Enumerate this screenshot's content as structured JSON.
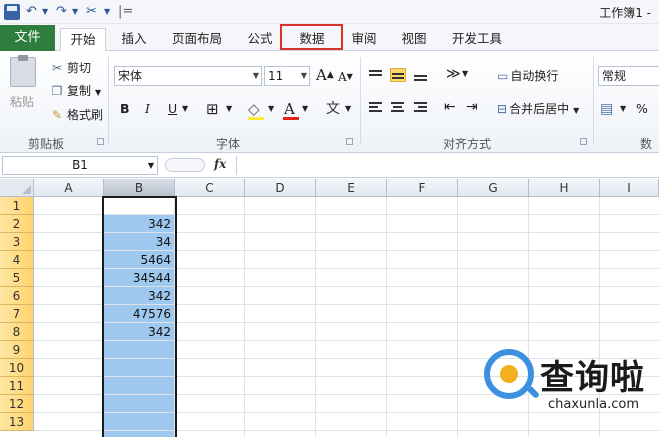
{
  "window": {
    "title": "工作簿1 -"
  },
  "quick_access": {
    "undo_glyph": "↶",
    "redo_glyph": "↷",
    "brush_glyph": "✂",
    "separator": "|="
  },
  "tabs": {
    "file": "文件",
    "items": [
      "开始",
      "插入",
      "页面布局",
      "公式",
      "数据",
      "审阅",
      "视图",
      "开发工具"
    ],
    "active": "开始",
    "highlighted": "数据"
  },
  "ribbon": {
    "clipboard": {
      "paste": "粘贴",
      "cut": "剪切",
      "copy": "复制",
      "format_painter": "格式刷",
      "group": "剪贴板"
    },
    "font": {
      "name": "宋体",
      "size": "11",
      "grow": "A",
      "shrink": "A",
      "bold": "B",
      "italic": "I",
      "underline": "U",
      "border": "⊞",
      "fill": "◇",
      "color": "A",
      "phonetic": "文",
      "group": "字体"
    },
    "alignment": {
      "wrap_text": "自动换行",
      "merge_center": "合并后居中",
      "group": "对齐方式"
    },
    "number": {
      "format": "常规",
      "percent": "%",
      "group": "数字"
    }
  },
  "formula_bar": {
    "name_box": "B1",
    "fx": "fx",
    "value": ""
  },
  "sheet": {
    "columns": [
      "A",
      "B",
      "C",
      "D",
      "E",
      "F",
      "G",
      "H",
      "I"
    ],
    "selected_column": "B",
    "rows": [
      "1",
      "2",
      "3",
      "4",
      "5",
      "6",
      "7",
      "8",
      "9",
      "10",
      "11",
      "12",
      "13"
    ],
    "b_values": [
      "",
      "342",
      "34",
      "5464",
      "34544",
      "342",
      "47576",
      "342",
      "",
      "",
      "",
      "",
      ""
    ]
  },
  "watermark": {
    "brand": "查询啦",
    "domain": "chaxunla.com"
  },
  "colors": {
    "file_tab": "#2d7d3e",
    "selection": "#9ec8ee",
    "highlight_box": "#d9342b",
    "font_color_bar": "#e02020"
  }
}
